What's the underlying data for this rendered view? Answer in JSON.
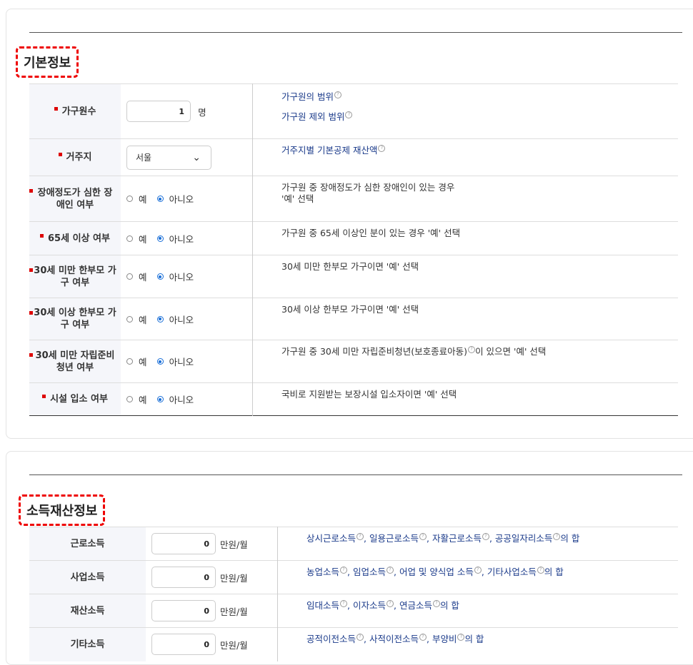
{
  "basic": {
    "title": "기본정보",
    "rows": [
      {
        "label": "가구원수",
        "value": "1",
        "unit": "명",
        "desc": [
          "가구원의 범위",
          "가구원 제외 범위"
        ]
      },
      {
        "label": "거주지",
        "select": "서울",
        "desc": [
          "거주지별 기본공제 재산액"
        ]
      },
      {
        "label": "장애정도가 심한 장애인 여부",
        "desc": [
          "가구원 중 장애정도가 심한 장애인이 있는 경우",
          "'예' 선택"
        ]
      },
      {
        "label": "65세 이상 여부",
        "desc": [
          "가구원 중 65세 이상인 분이 있는 경우 '예' 선택"
        ]
      },
      {
        "label": "30세 미만 한부모 가구 여부",
        "desc": [
          "30세 미만 한부모 가구이면 '예' 선택"
        ]
      },
      {
        "label": "30세 이상 한부모 가구 여부",
        "desc": [
          "30세 이상 한부모 가구이면 '예' 선택"
        ]
      },
      {
        "label": "30세 미만 자립준비 청년 여부",
        "desc_link": "가구원 중 30세 미만 자립준비청년(보호종료아동)",
        "desc_rest": "이 있으면 '예' 선택"
      },
      {
        "label": "시설 입소 여부",
        "desc": [
          "국비로 지원받는 보장시설 입소자이면 '예' 선택"
        ]
      }
    ],
    "radio_yes": "예",
    "radio_no": "아니오"
  },
  "income": {
    "title": "소득재산정보",
    "unit": "만원/월",
    "rows": [
      {
        "label": "근로소득",
        "value": "0",
        "items": [
          "상시근로소득",
          "일용근로소득",
          "자활근로소득",
          "공공일자리소득"
        ],
        "suffix": "의 합"
      },
      {
        "label": "사업소득",
        "value": "0",
        "items": [
          "농업소득",
          "임업소득",
          "어업 및 양식업 소득",
          "기타사업소득"
        ],
        "suffix": "의 합"
      },
      {
        "label": "재산소득",
        "value": "0",
        "items": [
          "임대소득",
          "이자소득",
          "연금소득"
        ],
        "suffix": "의 합"
      },
      {
        "label": "기타소득",
        "value": "0",
        "items": [
          "공적이전소득",
          "사적이전소득",
          "부양비"
        ],
        "suffix": "의 합"
      }
    ]
  },
  "icons": {
    "info": "info-circle-icon",
    "chevron": "chevron-down-icon"
  },
  "colors": {
    "required": "#dd0000",
    "link": "#1a3a8a",
    "radio_selected": "#1a6fd8",
    "highlight_border": "#ee0000"
  }
}
